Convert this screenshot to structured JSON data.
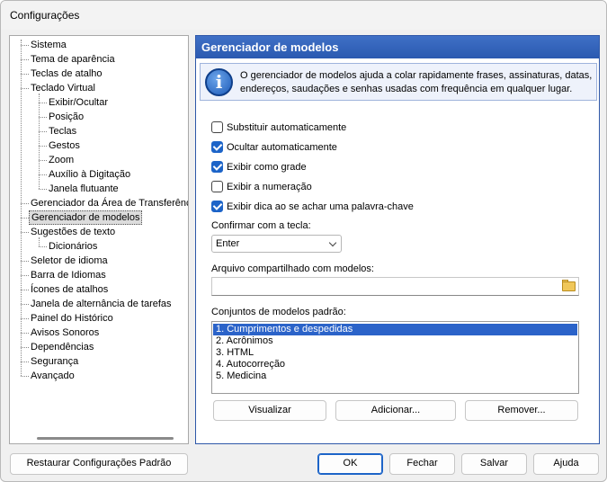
{
  "window": {
    "title": "Configurações"
  },
  "tree": {
    "items": [
      {
        "label": "Sistema",
        "level": 0
      },
      {
        "label": "Tema de aparência",
        "level": 0
      },
      {
        "label": "Teclas de atalho",
        "level": 0
      },
      {
        "label": "Teclado Virtual",
        "level": 0
      },
      {
        "label": "Exibir/Ocultar",
        "level": 1
      },
      {
        "label": "Posição",
        "level": 1
      },
      {
        "label": "Teclas",
        "level": 1
      },
      {
        "label": "Gestos",
        "level": 1
      },
      {
        "label": "Zoom",
        "level": 1
      },
      {
        "label": "Auxílio à Digitação",
        "level": 1
      },
      {
        "label": "Janela flutuante",
        "level": 1
      },
      {
        "label": "Gerenciador da Área de Transferência",
        "level": 0
      },
      {
        "label": "Gerenciador de modelos",
        "level": 0,
        "selected": true
      },
      {
        "label": "Sugestões de texto",
        "level": 0
      },
      {
        "label": "Dicionários",
        "level": 1
      },
      {
        "label": "Seletor de idioma",
        "level": 0
      },
      {
        "label": "Barra de Idiomas",
        "level": 0
      },
      {
        "label": "Ícones de atalhos",
        "level": 0
      },
      {
        "label": "Janela de alternância de tarefas",
        "level": 0
      },
      {
        "label": "Painel do Histórico",
        "level": 0
      },
      {
        "label": "Avisos Sonoros",
        "level": 0
      },
      {
        "label": "Dependências",
        "level": 0
      },
      {
        "label": "Segurança",
        "level": 0
      },
      {
        "label": "Avançado",
        "level": 0
      }
    ]
  },
  "panel": {
    "title": "Gerenciador de modelos",
    "info_text": "O gerenciador de modelos ajuda a colar rapidamente frases, assinaturas, datas, endereços, saudações e senhas usadas com frequência em qualquer lugar.",
    "checkboxes": [
      {
        "label": "Substituir automaticamente",
        "checked": false
      },
      {
        "label": "Ocultar automaticamente",
        "checked": true
      },
      {
        "label": "Exibir como grade",
        "checked": true
      },
      {
        "label": "Exibir a numeração",
        "checked": false
      },
      {
        "label": "Exibir dica ao se achar uma palavra-chave",
        "checked": true
      }
    ],
    "confirm_label": "Confirmar com a tecla:",
    "confirm_value": "Enter",
    "shared_file_label": "Arquivo compartilhado com modelos:",
    "shared_file_value": "",
    "sets_label": "Conjuntos de modelos padrão:",
    "sets": [
      {
        "label": "1. Cumprimentos e despedidas",
        "selected": true
      },
      {
        "label": "2. Acrônimos",
        "selected": false
      },
      {
        "label": "3. HTML",
        "selected": false
      },
      {
        "label": "4. Autocorreção",
        "selected": false
      },
      {
        "label": "5. Medicina",
        "selected": false
      }
    ],
    "buttons": {
      "view": "Visualizar",
      "add": "Adicionar...",
      "remove": "Remover..."
    }
  },
  "footer": {
    "restore": "Restaurar Configurações Padrão",
    "ok": "OK",
    "cancel": "Fechar",
    "save": "Salvar",
    "help": "Ajuda"
  },
  "colors": {
    "accent": "#2a59b0",
    "selection": "#2b63c9",
    "checkbox": "#1d64c8"
  }
}
